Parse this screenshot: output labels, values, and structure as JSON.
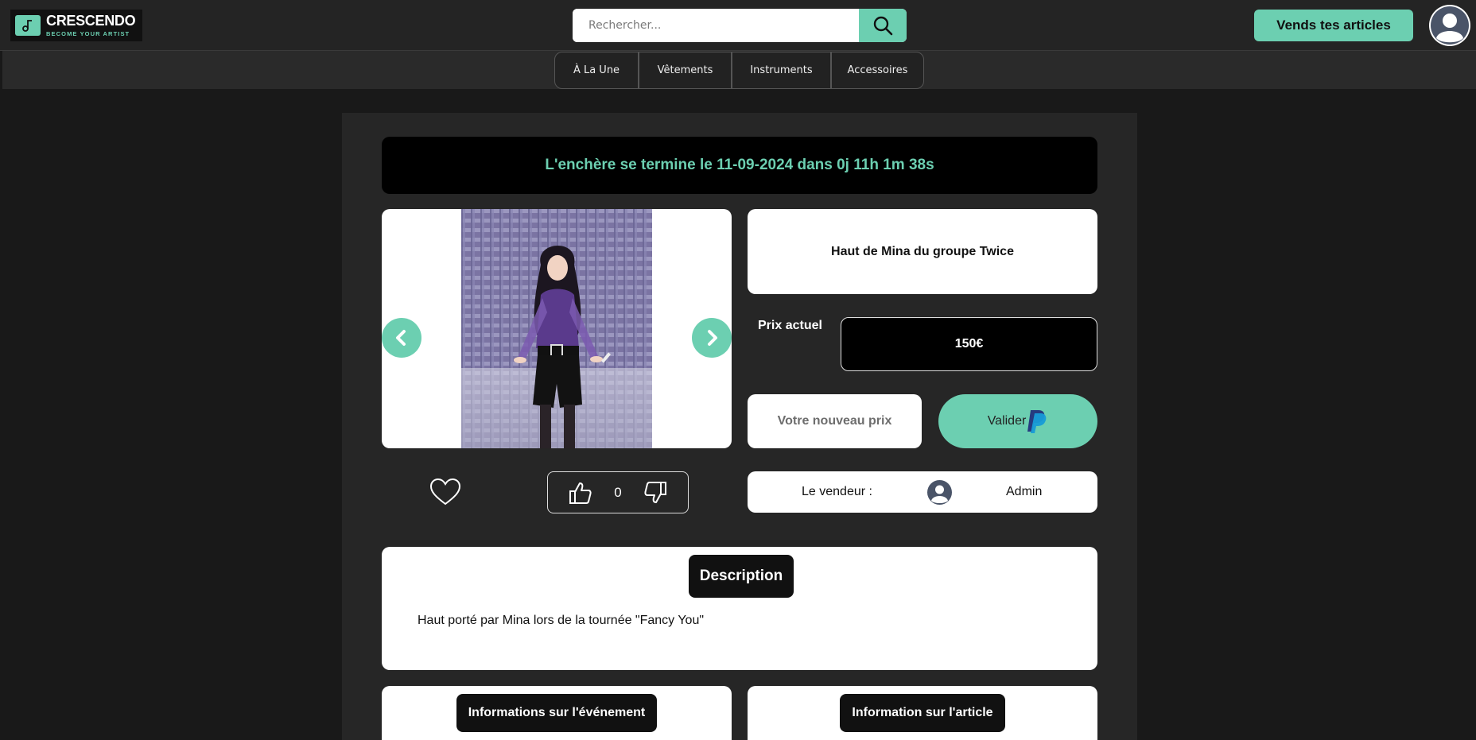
{
  "brand": {
    "name": "CRESCENDO",
    "tagline": "BECOME YOUR ARTIST"
  },
  "search": {
    "placeholder": "Rechercher..."
  },
  "header": {
    "sell_label": "Vends tes articles"
  },
  "categories": [
    "À La Une",
    "Vêtements",
    "Instruments",
    "Accessoires"
  ],
  "auction": {
    "timer_text": "L'enchère se termine le 11-09-2024 dans 0j 11h 1m 38s",
    "title": "Haut de Mina du groupe Twice",
    "price_label": "Prix actuel",
    "price_value": "150€",
    "bid_placeholder": "Votre nouveau prix",
    "validate_label": "Valider"
  },
  "votes": {
    "count": "0"
  },
  "seller": {
    "label": "Le vendeur :",
    "name": "Admin"
  },
  "description": {
    "heading": "Description",
    "text": "Haut porté par Mina lors de la tournée \"Fancy You\""
  },
  "sections": {
    "event_heading": "Informations sur l'événement",
    "article_heading": "Information sur l'article"
  },
  "colors": {
    "accent": "#6ccfb1",
    "page_background": "#191919",
    "panel_background": "#262626",
    "card": "#ffffff",
    "dark_box": "#000000"
  },
  "icons": [
    "music-note-icon",
    "search-icon",
    "user-avatar-icon",
    "chevron-left-icon",
    "chevron-right-icon",
    "heart-icon",
    "thumbs-up-icon",
    "thumbs-down-icon",
    "paypal-icon"
  ]
}
